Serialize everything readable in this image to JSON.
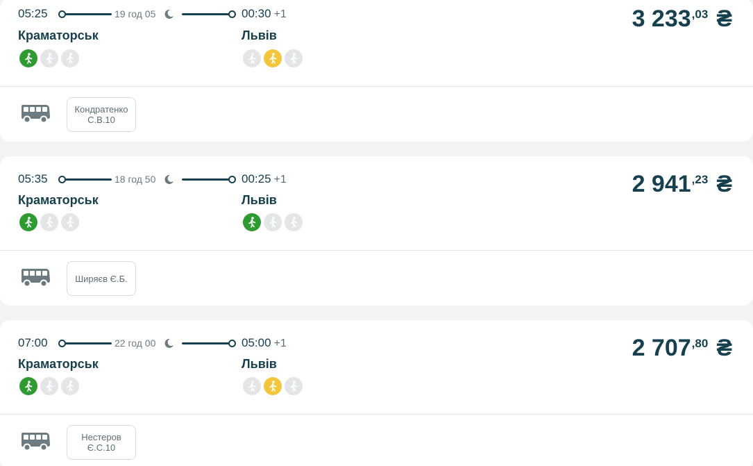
{
  "trips": [
    {
      "depart_time": "05:25",
      "duration": "19 год 05",
      "arrive_time": "00:30",
      "arrive_day": "+1",
      "from_city": "Краматорськ",
      "to_city": "Львів",
      "price_main": "3 233",
      "price_cents": ",03",
      "currency": "₴",
      "from_icons": [
        "green",
        "grey",
        "grey"
      ],
      "to_icons": [
        "grey",
        "yellow",
        "grey"
      ],
      "driver": "Кондратенко С.В.10"
    },
    {
      "depart_time": "05:35",
      "duration": "18 год 50",
      "arrive_time": "00:25",
      "arrive_day": "+1",
      "from_city": "Краматорськ",
      "to_city": "Львів",
      "price_main": "2 941",
      "price_cents": ",23",
      "currency": "₴",
      "from_icons": [
        "green",
        "grey",
        "grey"
      ],
      "to_icons": [
        "green",
        "grey",
        "grey"
      ],
      "driver": "Ширяєв Є.Б."
    },
    {
      "depart_time": "07:00",
      "duration": "22 год 00",
      "arrive_time": "05:00",
      "arrive_day": "+1",
      "from_city": "Краматорськ",
      "to_city": "Львів",
      "price_main": "2 707",
      "price_cents": ",80",
      "currency": "₴",
      "from_icons": [
        "green",
        "grey",
        "grey"
      ],
      "to_icons": [
        "grey",
        "yellow",
        "grey"
      ],
      "driver": "Нестеров Є.С.10"
    }
  ],
  "icons": {
    "transport": "bus-icon",
    "night": "moon-icon",
    "stop_status": "walking-person-icon"
  },
  "colors": {
    "primary": "#17404f",
    "available": "#2e9a32",
    "partial": "#f3c53b",
    "unavailable": "#e3e5e6"
  }
}
